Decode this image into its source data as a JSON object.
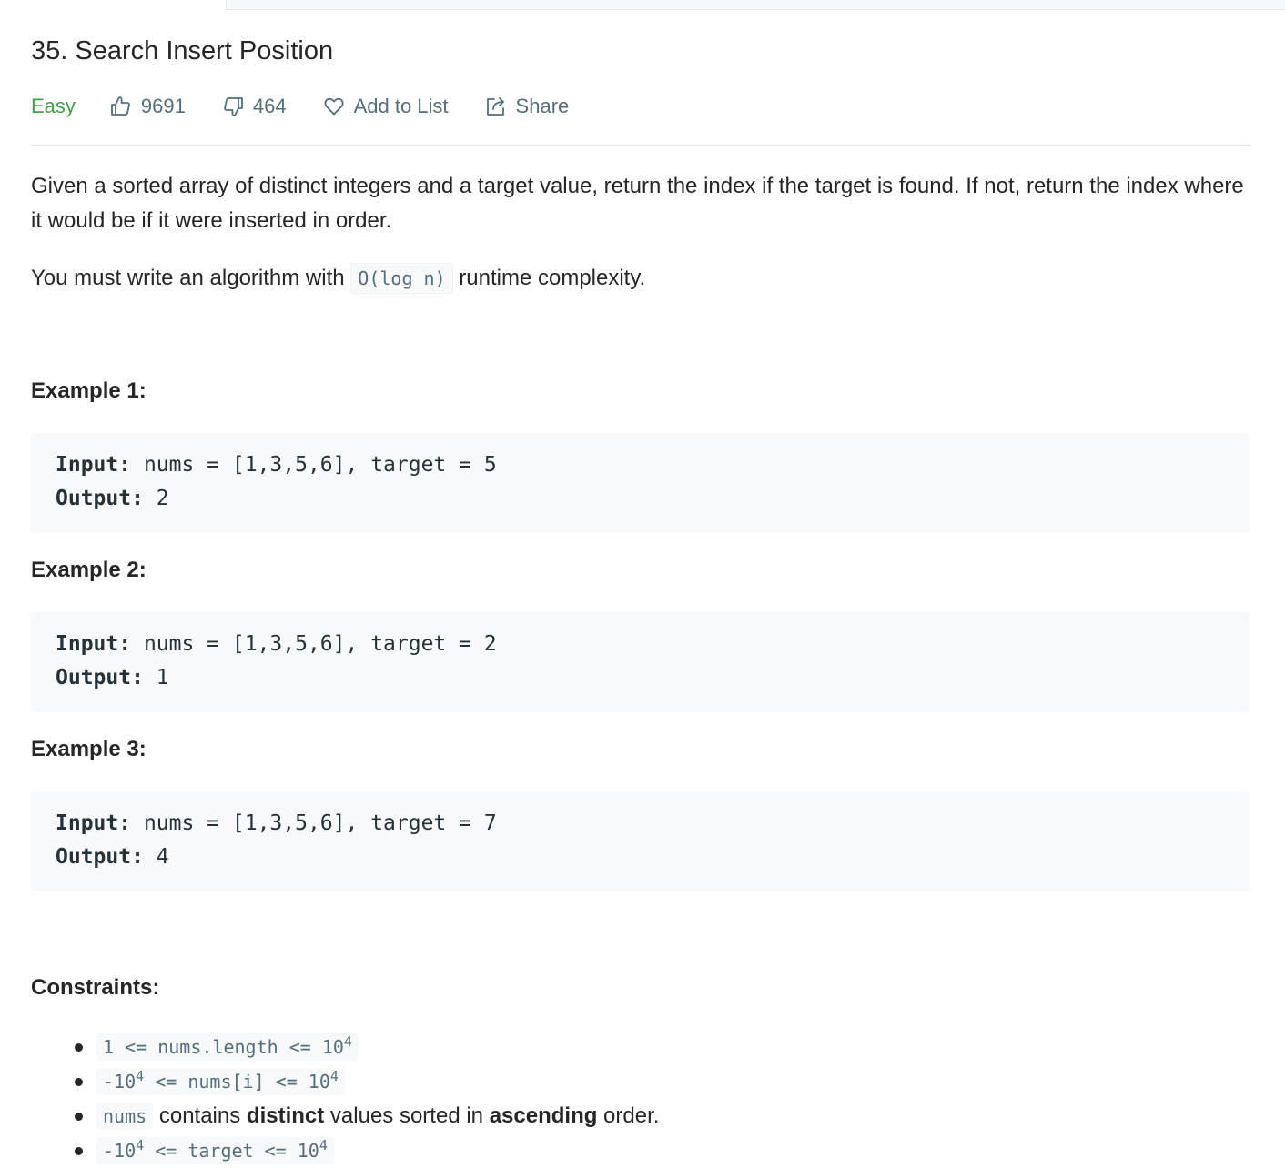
{
  "problem": {
    "title": "35. Search Insert Position",
    "difficulty": "Easy",
    "likes": "9691",
    "dislikes": "464",
    "add_to_list": "Add to List",
    "share": "Share",
    "colors": {
      "difficulty": "#43a047",
      "meta": "#546e7a",
      "code_bg": "#f7f9fa"
    }
  },
  "description": {
    "para1": "Given a sorted array of distinct integers and a target value, return the index if the target is found. If not, return the index where it would be if it were inserted in order.",
    "para2_before": "You must write an algorithm with ",
    "para2_code": "O(log n)",
    "para2_after": " runtime complexity."
  },
  "examples": [
    {
      "heading": "Example 1:",
      "input_label": "Input:",
      "input": " nums = [1,3,5,6], target = 5",
      "output_label": "Output:",
      "output": " 2"
    },
    {
      "heading": "Example 2:",
      "input_label": "Input:",
      "input": " nums = [1,3,5,6], target = 2",
      "output_label": "Output:",
      "output": " 1"
    },
    {
      "heading": "Example 3:",
      "input_label": "Input:",
      "input": " nums = [1,3,5,6], target = 7",
      "output_label": "Output:",
      "output": " 4"
    }
  ],
  "constraints": {
    "heading": "Constraints:",
    "c1_code": "1 <= nums.length <= 10",
    "c1_sup": "4",
    "c2_a": "-10",
    "c2_sup1": "4",
    "c2_b": " <= nums[i] <= 10",
    "c2_sup2": "4",
    "c3_code": "nums",
    "c3_t1": " contains ",
    "c3_b1": "distinct",
    "c3_t2": " values sorted in ",
    "c3_b2": "ascending",
    "c3_t3": " order.",
    "c4_a": "-10",
    "c4_sup1": "4",
    "c4_b": " <= target <= 10",
    "c4_sup2": "4"
  }
}
